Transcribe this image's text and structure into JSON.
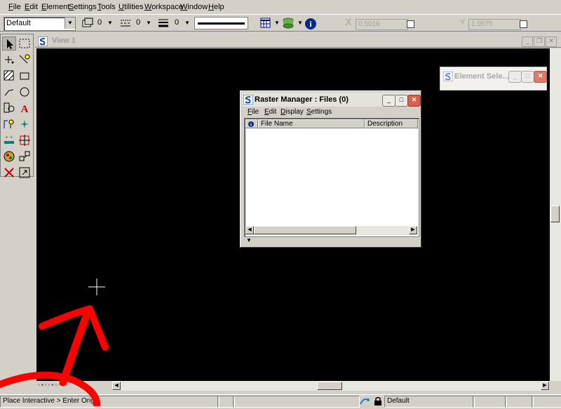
{
  "menubar": {
    "items": [
      {
        "ul": "F",
        "rest": "ile"
      },
      {
        "ul": "E",
        "rest": "dit"
      },
      {
        "ul": "E",
        "rest": "lement"
      },
      {
        "ul": "S",
        "rest": "ettings"
      },
      {
        "ul": "T",
        "rest": "ools"
      },
      {
        "ul": "U",
        "rest": "tilities"
      },
      {
        "ul": "W",
        "rest": "orkspace"
      },
      {
        "ul": "W",
        "rest": "indow"
      },
      {
        "ul": "H",
        "rest": "elp"
      }
    ]
  },
  "attributes": {
    "level": "Default",
    "color_value": "0",
    "style_value": "0",
    "weight_value": "0"
  },
  "coords": {
    "x_label": "X",
    "x_value": "0.5016",
    "y_label": "Y",
    "y_value": "1.0575"
  },
  "view": {
    "title": "View 1"
  },
  "raster_manager": {
    "title": "Raster Manager : Files (0)",
    "menu": [
      {
        "ul": "F",
        "rest": "ile"
      },
      {
        "ul": "E",
        "rest": "dit"
      },
      {
        "ul": "D",
        "rest": "isplay"
      },
      {
        "ul": "S",
        "rest": "ettings"
      }
    ],
    "columns": [
      "File Name",
      "Description"
    ]
  },
  "element_selection": {
    "title": "Element Sele..."
  },
  "status": {
    "prompt": "Place Interactive > Enter Origin",
    "level": "Default"
  },
  "colors": {
    "canvas": "#000000",
    "annotation_red": "#ff0000",
    "ui_face": "#d4d0c8"
  }
}
